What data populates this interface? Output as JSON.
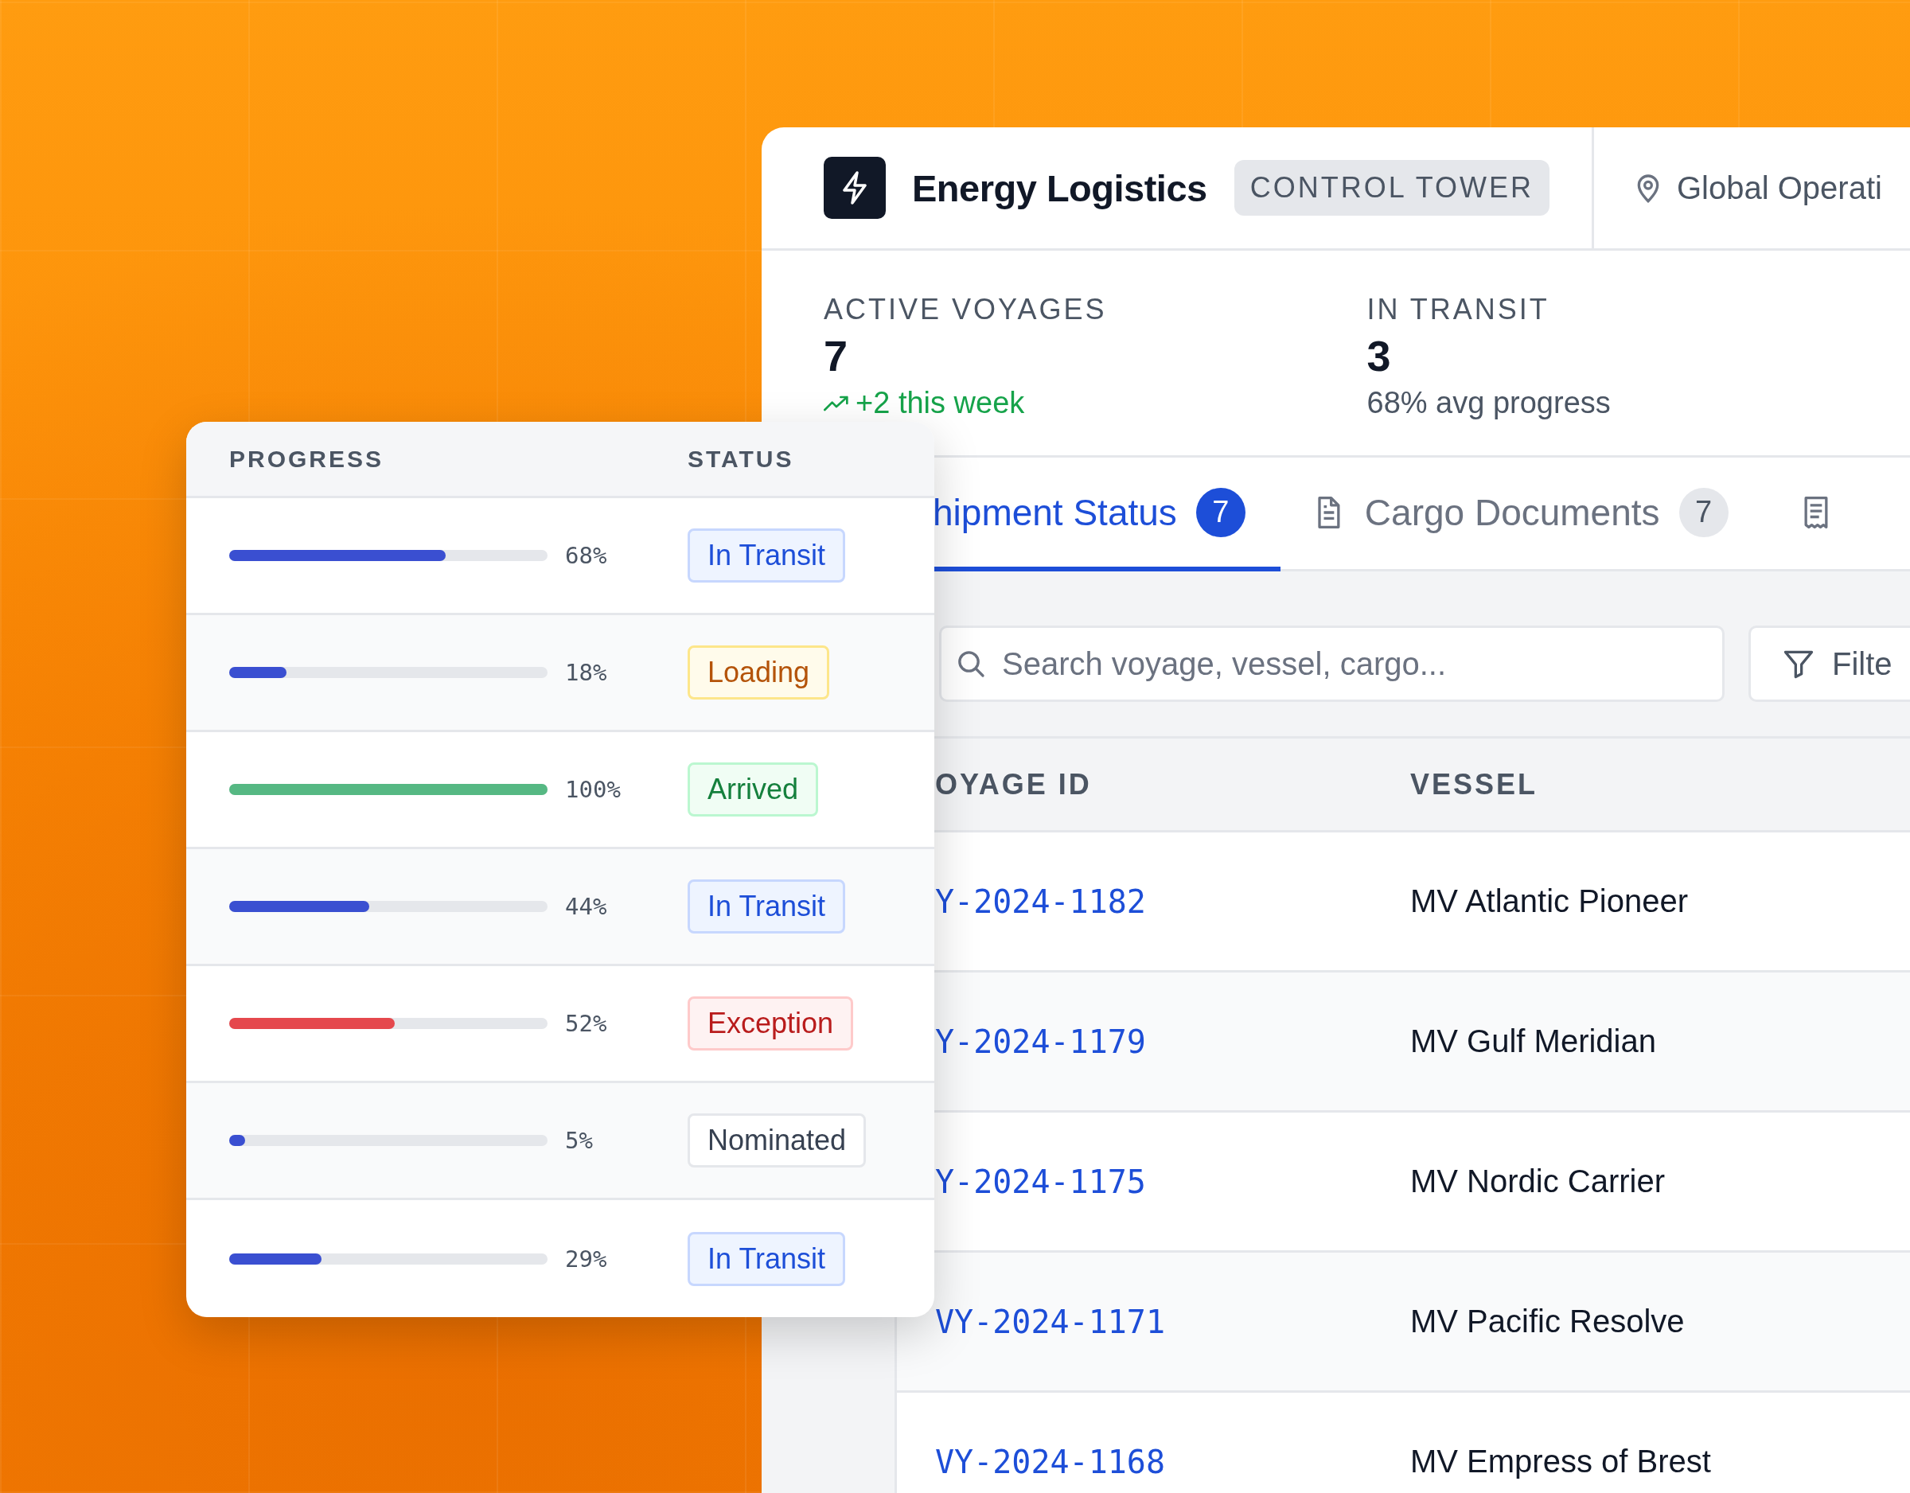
{
  "header": {
    "title": "Energy Logistics",
    "badge": "CONTROL TOWER",
    "location": "Global Operati"
  },
  "stats": [
    {
      "label": "ACTIVE VOYAGES",
      "value": "7",
      "note": "+2 this week",
      "kind": "trend"
    },
    {
      "label": "IN TRANSIT",
      "value": "3",
      "note": "68% avg progress",
      "kind": "plain"
    }
  ],
  "tabs": [
    {
      "label": "hipment Status",
      "count": "7",
      "selected": true
    },
    {
      "label": "Cargo Documents",
      "count": "7",
      "selected": false
    },
    {
      "selected": false
    }
  ],
  "search": {
    "placeholder": "Search voyage, vessel, cargo..."
  },
  "filter_button": "Filte",
  "table": {
    "columns": [
      "OYAGE ID",
      "VESSEL"
    ],
    "rows": [
      {
        "voyage_id": "Y-2024-1182",
        "vessel": "MV Atlantic Pioneer"
      },
      {
        "voyage_id": "Y-2024-1179",
        "vessel": "MV Gulf Meridian"
      },
      {
        "voyage_id": "Y-2024-1175",
        "vessel": "MV Nordic Carrier"
      },
      {
        "voyage_id": "VY-2024-1171",
        "vessel": "MV Pacific Resolve"
      },
      {
        "voyage_id": "VY-2024-1168",
        "vessel": "MV Empress of Brest"
      }
    ]
  },
  "progress_card": {
    "columns": [
      "PROGRESS",
      "STATUS"
    ],
    "rows": [
      {
        "level": 0.68,
        "reading": "68%",
        "status": "In Transit",
        "kind": "transit"
      },
      {
        "level": 0.18,
        "reading": "18%",
        "status": "Loading",
        "kind": "loading"
      },
      {
        "level": 1.0,
        "reading": "100%",
        "status": "Arrived",
        "kind": "arrived"
      },
      {
        "level": 0.44,
        "reading": "44%",
        "status": "In Transit",
        "kind": "transit"
      },
      {
        "level": 0.52,
        "reading": "52%",
        "status": "Exception",
        "kind": "exception"
      },
      {
        "level": 0.05,
        "reading": "5%",
        "status": "Nominated",
        "kind": "nominated"
      },
      {
        "level": 0.29,
        "reading": "29%",
        "status": "In Transit",
        "kind": "transit"
      }
    ]
  }
}
